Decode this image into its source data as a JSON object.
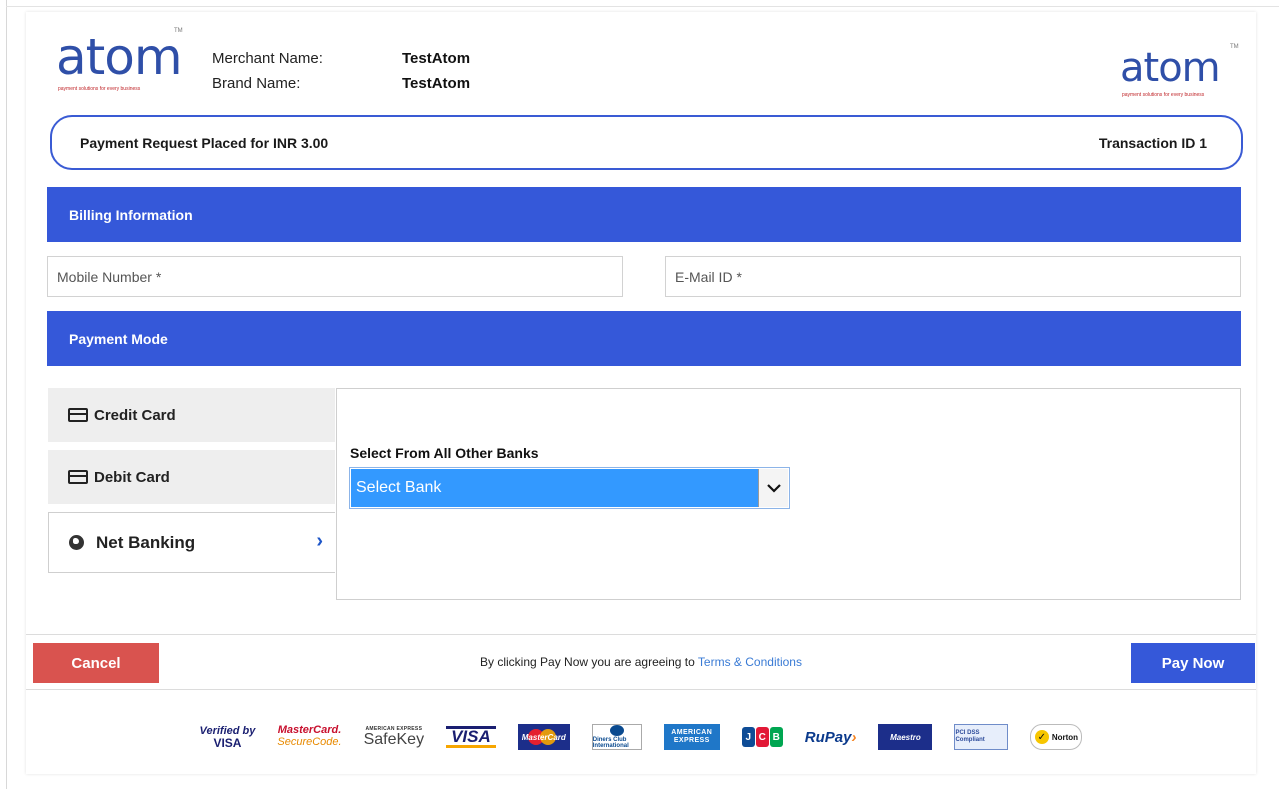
{
  "header": {
    "logo_text": "atom",
    "logo_tagline": "payment solutions for every business",
    "merchant_label": "Merchant Name:",
    "merchant_value": "TestAtom",
    "brand_label": "Brand Name:",
    "brand_value": "TestAtom"
  },
  "amount_bar": {
    "request_text": "Payment Request Placed for INR  3.00",
    "transaction_text": "Transaction ID  1"
  },
  "billing": {
    "title": "Billing Information",
    "mobile_placeholder": "Mobile Number *",
    "email_placeholder": "E-Mail ID *"
  },
  "payment_mode": {
    "title": "Payment Mode",
    "tabs": [
      {
        "label": "Credit Card",
        "icon": "credit-card-icon"
      },
      {
        "label": "Debit Card",
        "icon": "credit-card-icon"
      },
      {
        "label": "Net Banking",
        "icon": "globe-icon",
        "active": true
      }
    ],
    "panel_label": "Select From All Other Banks",
    "bank_select_value": "Select Bank"
  },
  "footer": {
    "cancel_label": "Cancel",
    "agree_text": "By clicking Pay Now you are agreeing to ",
    "terms_link": "Terms & Conditions",
    "pay_label": "Pay Now"
  },
  "trust_logos": {
    "verified_top": "Verified by",
    "verified_bottom": "VISA",
    "mc_top": "MasterCard.",
    "mc_bottom": "SecureCode.",
    "safekey_top": "AMERICAN EXPRESS",
    "safekey_main": "SafeKey",
    "visa": "VISA",
    "mastercard": "MasterCard",
    "diners": "Diners Club International",
    "amex_top": "AMERICAN",
    "amex_bottom": "EXPRESS",
    "jcb": [
      "J",
      "C",
      "B"
    ],
    "rupay": "RuPay",
    "maestro": "Maestro",
    "pci": "PCI DSS Compliant",
    "norton": "Norton"
  },
  "colors": {
    "brand_blue": "#3558d9",
    "cancel_red": "#d9534f",
    "select_highlight": "#3399ff",
    "link_blue": "#3a7bd5"
  }
}
